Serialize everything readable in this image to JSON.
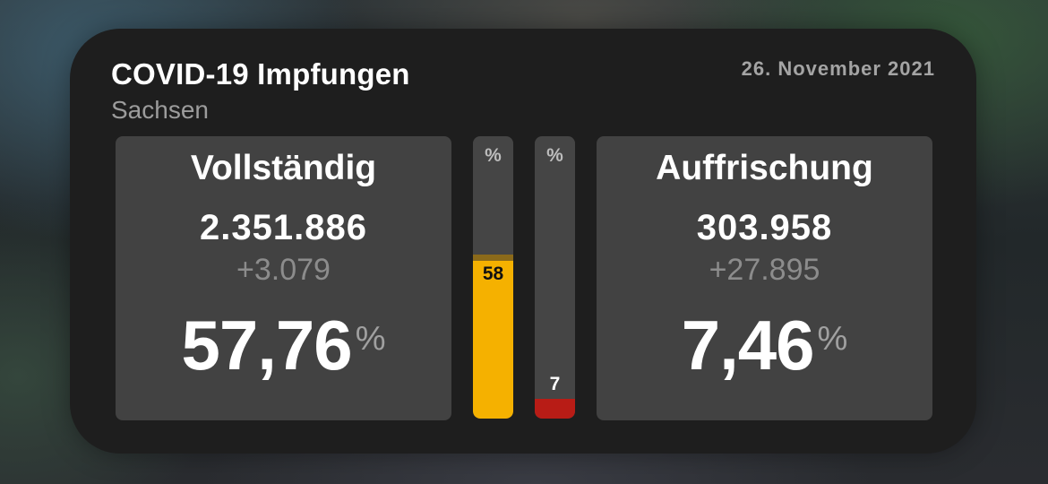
{
  "widget": {
    "title": "COVID-19 Impfungen",
    "region": "Sachsen",
    "date": "26. November 2021"
  },
  "full": {
    "label": "Vollständig",
    "total": "2.351.886",
    "delta": "+3.079",
    "percent": "57,76",
    "percent_sign": "%"
  },
  "booster": {
    "label": "Auffrischung",
    "total": "303.958",
    "delta": "+27.895",
    "percent": "7,46",
    "percent_sign": "%"
  },
  "bars": {
    "full": {
      "sign": "%",
      "value": "58",
      "fraction": 0.58,
      "color": "#f5b100"
    },
    "booster": {
      "sign": "%",
      "value": "7",
      "fraction": 0.07,
      "color": "#b81c16"
    }
  }
}
